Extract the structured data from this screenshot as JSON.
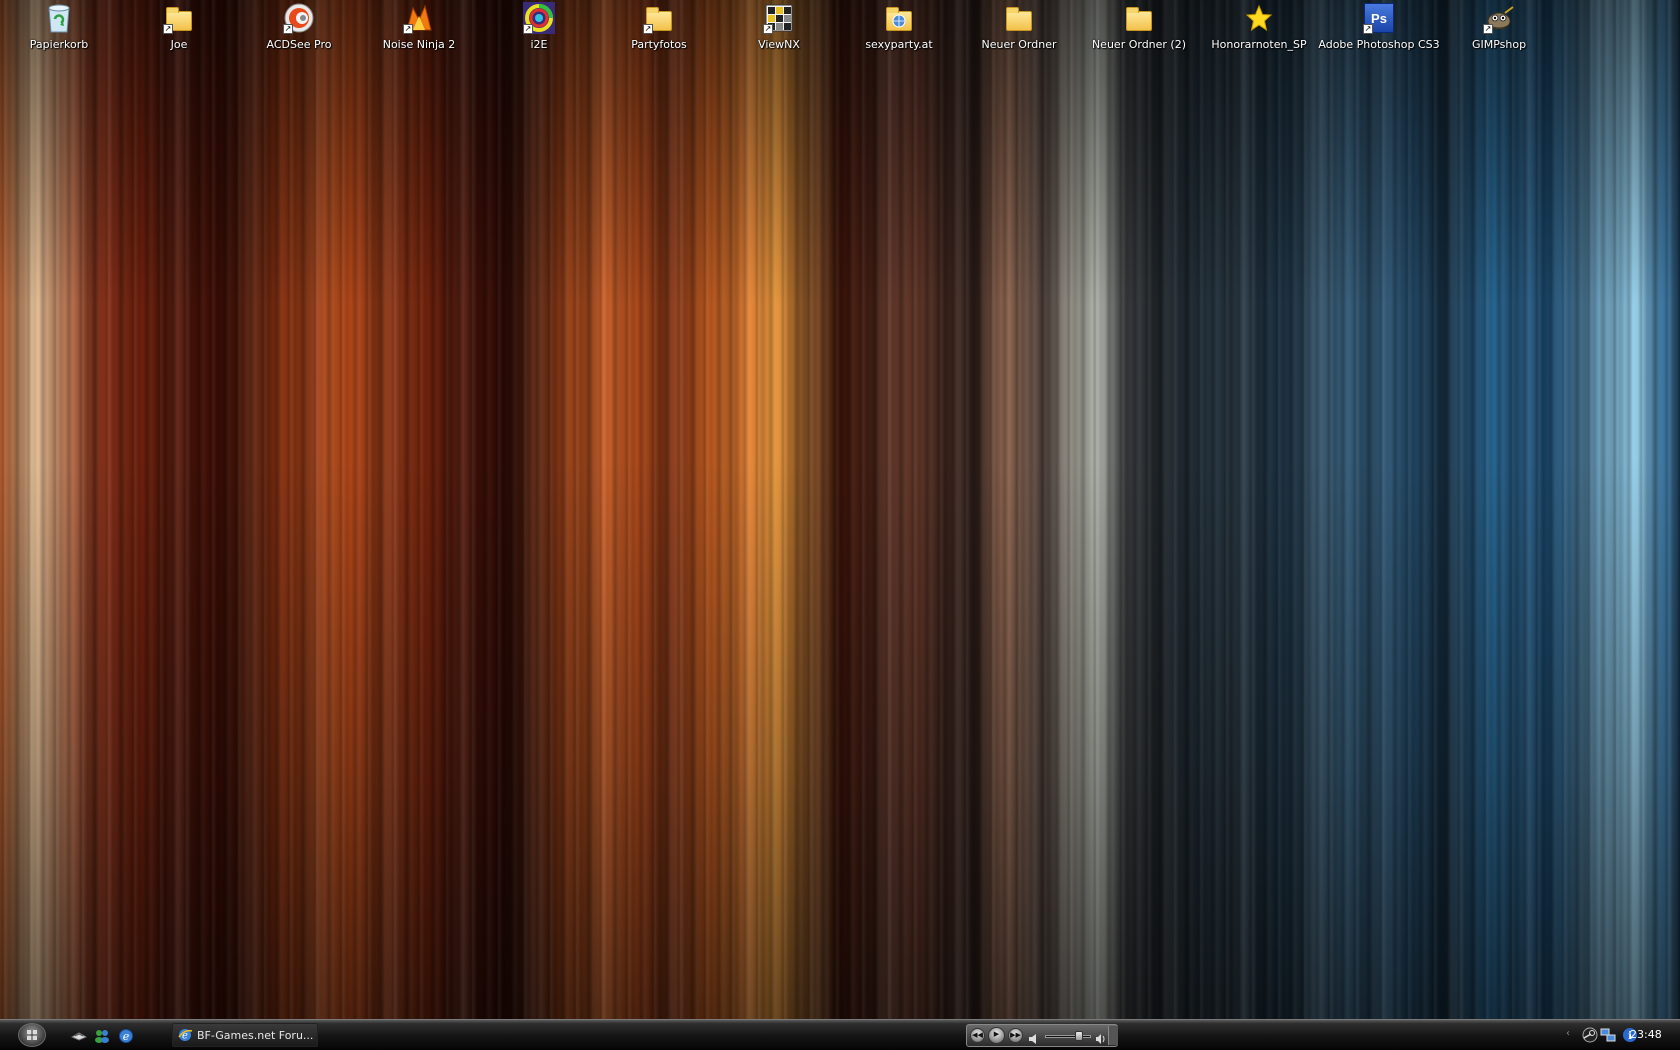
{
  "desktop": {
    "icons": [
      {
        "label": "Papierkorb",
        "icon": "recycle-bin-icon",
        "shortcut": false
      },
      {
        "label": "Joe",
        "icon": "folder-icon",
        "shortcut": true
      },
      {
        "label": "ACDSee Pro",
        "icon": "acdsee-icon",
        "shortcut": true
      },
      {
        "label": "Noise Ninja 2",
        "icon": "noise-ninja-icon",
        "shortcut": true
      },
      {
        "label": "i2E",
        "icon": "i2e-icon",
        "shortcut": true
      },
      {
        "label": "Partyfotos",
        "icon": "folder-icon",
        "shortcut": true
      },
      {
        "label": "ViewNX",
        "icon": "viewnx-icon",
        "shortcut": true
      },
      {
        "label": "sexyparty.at",
        "icon": "web-folder-icon",
        "shortcut": false
      },
      {
        "label": "Neuer Ordner",
        "icon": "folder-icon",
        "shortcut": false
      },
      {
        "label": "Neuer Ordner (2)",
        "icon": "folder-icon",
        "shortcut": false
      },
      {
        "label": "Honorarnoten_SP",
        "icon": "star-icon",
        "shortcut": false
      },
      {
        "label": "Adobe Photoshop CS3",
        "icon": "photoshop-icon",
        "shortcut": true,
        "badge": "Ps"
      },
      {
        "label": "GIMPshop",
        "icon": "gimp-icon",
        "shortcut": true
      }
    ]
  },
  "taskbar": {
    "start_button": "start-icon",
    "quick_launch": [
      "show-desktop-icon",
      "messenger-icon",
      "internet-explorer-icon"
    ],
    "tasks": [
      {
        "label": "BF-Games.net Foru...",
        "icon": "internet-explorer-icon"
      }
    ],
    "media_player": {
      "buttons": [
        "previous-icon",
        "play-icon",
        "next-icon"
      ],
      "volume_level": 0.8
    },
    "clock": "23:48"
  },
  "colors": {
    "taskbar": "#141414",
    "label_text": "#ffffff",
    "folder": "#f2c14a",
    "photoshop": "#2a5ec8"
  }
}
